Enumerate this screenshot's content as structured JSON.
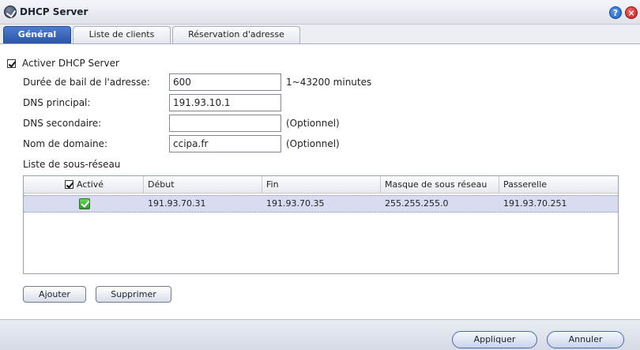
{
  "window": {
    "title": "DHCP Server",
    "help_icon": "help-icon",
    "close_icon": "close-icon"
  },
  "tabs": [
    {
      "label": "Général",
      "active": true
    },
    {
      "label": "Liste de clients",
      "active": false
    },
    {
      "label": "Réservation d'adresse",
      "active": false
    }
  ],
  "form": {
    "enable_label": "Activer DHCP Server",
    "enable_checked": true,
    "lease": {
      "label": "Durée de bail de l'adresse:",
      "value": "600",
      "hint": "1~43200 minutes"
    },
    "dns_primary": {
      "label": "DNS principal:",
      "value": "191.93.10.1"
    },
    "dns_secondary": {
      "label": "DNS secondaire:",
      "value": "",
      "hint": "(Optionnel)"
    },
    "domain": {
      "label": "Nom de domaine:",
      "value": "ccipa.fr",
      "hint": "(Optionnel)"
    },
    "subnet_list_label": "Liste de sous-réseau"
  },
  "table": {
    "columns": [
      "Activé",
      "Début",
      "Fin",
      "Masque de sous réseau",
      "Passerelle"
    ],
    "rows": [
      {
        "active": true,
        "start": "191.93.70.31",
        "end": "191.93.70.35",
        "mask": "255.255.255.0",
        "gateway": "191.93.70.251"
      }
    ]
  },
  "buttons": {
    "add": "Ajouter",
    "remove": "Supprimer",
    "apply": "Appliquer",
    "cancel": "Annuler"
  },
  "colors": {
    "active_tab": "#2b55a6",
    "selected_row": "#d9dcf0"
  }
}
